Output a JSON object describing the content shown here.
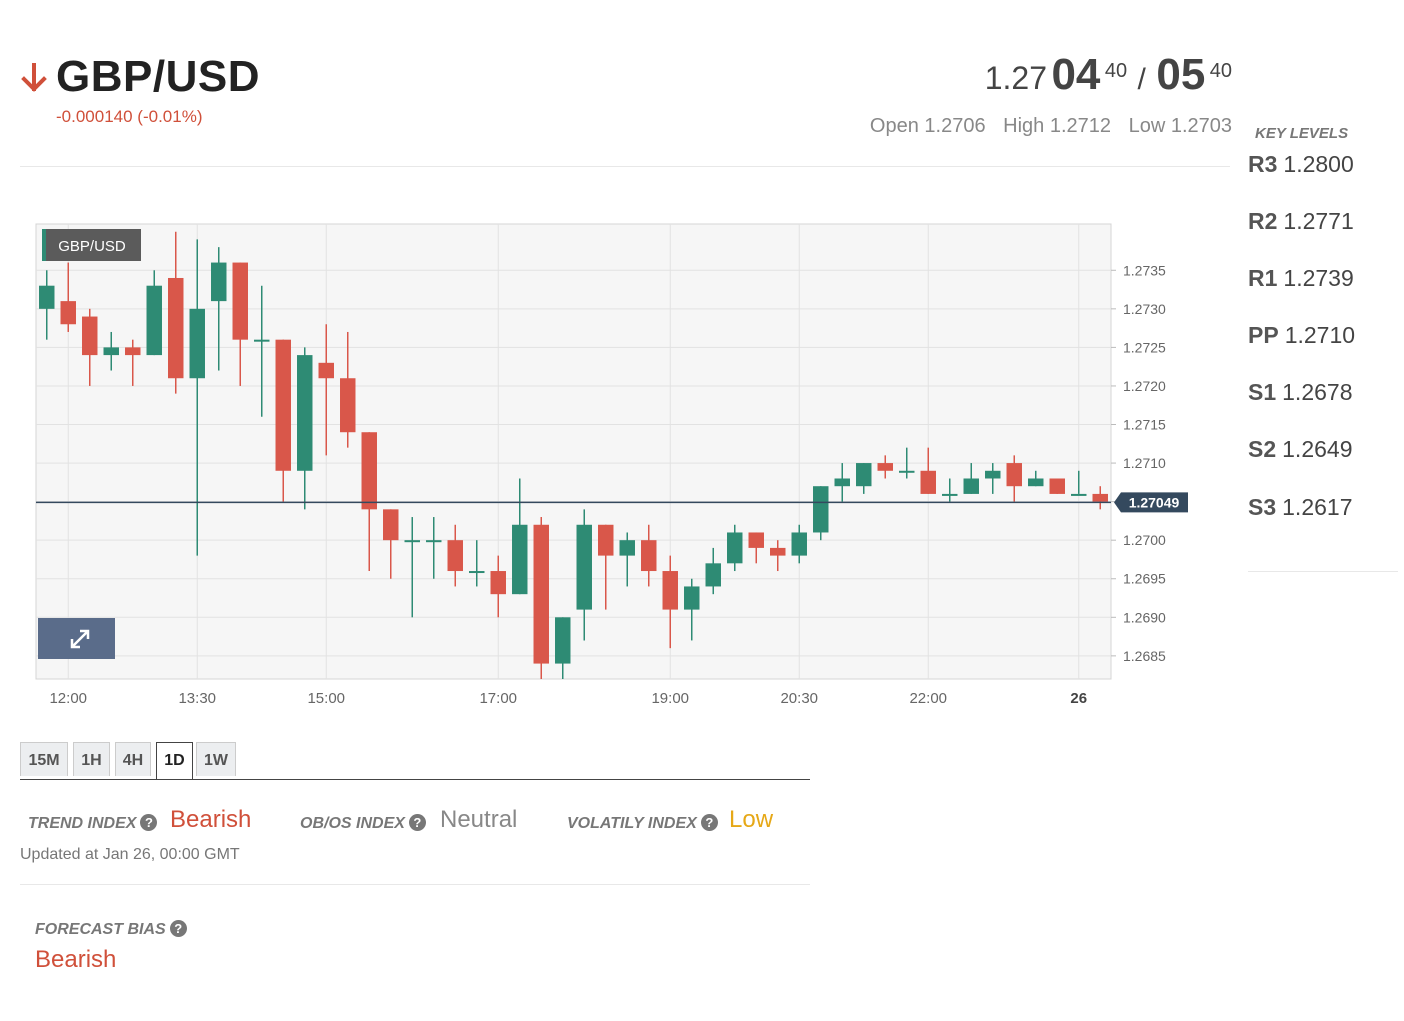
{
  "header": {
    "pair": "GBP/USD",
    "direction_icon": "arrow-down-icon",
    "change": "-0.000140 (-0.01%)",
    "bid": {
      "base": "1.27",
      "big": "04",
      "sup": "40"
    },
    "ask": {
      "big": "05",
      "sup": "40"
    },
    "slash": "/",
    "open": "Open 1.2706",
    "high": "High 1.2712",
    "low": "Low 1.2703"
  },
  "key_levels": {
    "title": "KEY LEVELS",
    "levels": [
      {
        "name": "R3",
        "value": "1.2800"
      },
      {
        "name": "R2",
        "value": "1.2771"
      },
      {
        "name": "R1",
        "value": "1.2739"
      },
      {
        "name": "PP",
        "value": "1.2710"
      },
      {
        "name": "S1",
        "value": "1.2678"
      },
      {
        "name": "S2",
        "value": "1.2649"
      },
      {
        "name": "S3",
        "value": "1.2617"
      }
    ]
  },
  "colors": {
    "up": "#2e8b74",
    "down": "#d9574a",
    "bearish": "#d0503a",
    "neutral": "#888888",
    "low": "#e6a817",
    "price_line": "#34495e"
  },
  "chart_data": {
    "type": "candlestick",
    "title": "GBP/USD",
    "ylim": [
      1.2682,
      1.2741
    ],
    "y_ticks": [
      "1.2735",
      "1.2730",
      "1.2725",
      "1.2720",
      "1.2715",
      "1.2710",
      "1.2705",
      "1.2700",
      "1.2695",
      "1.2690",
      "1.2685"
    ],
    "x_ticks": [
      "12:00",
      "13:30",
      "15:00",
      "17:00",
      "19:00",
      "20:30",
      "22:00",
      "26"
    ],
    "x_ticks_bold": [
      "26"
    ],
    "current_price": "1.27049",
    "current_value": 1.27049,
    "candles": [
      {
        "o": 1.273,
        "h": 1.2735,
        "l": 1.2726,
        "c": 1.2733
      },
      {
        "o": 1.2731,
        "h": 1.2736,
        "l": 1.2727,
        "c": 1.2728
      },
      {
        "o": 1.2729,
        "h": 1.273,
        "l": 1.272,
        "c": 1.2724
      },
      {
        "o": 1.2724,
        "h": 1.2727,
        "l": 1.2722,
        "c": 1.2725
      },
      {
        "o": 1.2725,
        "h": 1.2726,
        "l": 1.272,
        "c": 1.2724
      },
      {
        "o": 1.2724,
        "h": 1.2735,
        "l": 1.2724,
        "c": 1.2733
      },
      {
        "o": 1.2734,
        "h": 1.274,
        "l": 1.2719,
        "c": 1.2721
      },
      {
        "o": 1.2721,
        "h": 1.2739,
        "l": 1.2698,
        "c": 1.273
      },
      {
        "o": 1.2731,
        "h": 1.2738,
        "l": 1.2722,
        "c": 1.2736
      },
      {
        "o": 1.2736,
        "h": 1.2736,
        "l": 1.272,
        "c": 1.2726
      },
      {
        "o": 1.2726,
        "h": 1.2733,
        "l": 1.2716,
        "c": 1.2726
      },
      {
        "o": 1.2726,
        "h": 1.2726,
        "l": 1.2705,
        "c": 1.2709
      },
      {
        "o": 1.2709,
        "h": 1.2725,
        "l": 1.2704,
        "c": 1.2724
      },
      {
        "o": 1.2723,
        "h": 1.2728,
        "l": 1.2711,
        "c": 1.2721
      },
      {
        "o": 1.2721,
        "h": 1.2727,
        "l": 1.2712,
        "c": 1.2714
      },
      {
        "o": 1.2714,
        "h": 1.2714,
        "l": 1.2696,
        "c": 1.2704
      },
      {
        "o": 1.2704,
        "h": 1.2703,
        "l": 1.2695,
        "c": 1.27
      },
      {
        "o": 1.27,
        "h": 1.2703,
        "l": 1.269,
        "c": 1.27
      },
      {
        "o": 1.27,
        "h": 1.2703,
        "l": 1.2695,
        "c": 1.27
      },
      {
        "o": 1.27,
        "h": 1.2702,
        "l": 1.2694,
        "c": 1.2696
      },
      {
        "o": 1.2696,
        "h": 1.27,
        "l": 1.2694,
        "c": 1.2696
      },
      {
        "o": 1.2696,
        "h": 1.2698,
        "l": 1.269,
        "c": 1.2693
      },
      {
        "o": 1.2693,
        "h": 1.2708,
        "l": 1.2693,
        "c": 1.2702
      },
      {
        "o": 1.2702,
        "h": 1.2703,
        "l": 1.2682,
        "c": 1.2684
      },
      {
        "o": 1.2684,
        "h": 1.269,
        "l": 1.2682,
        "c": 1.269
      },
      {
        "o": 1.2691,
        "h": 1.2704,
        "l": 1.2687,
        "c": 1.2702
      },
      {
        "o": 1.2702,
        "h": 1.2702,
        "l": 1.2691,
        "c": 1.2698
      },
      {
        "o": 1.2698,
        "h": 1.2701,
        "l": 1.2694,
        "c": 1.27
      },
      {
        "o": 1.27,
        "h": 1.2702,
        "l": 1.2694,
        "c": 1.2696
      },
      {
        "o": 1.2696,
        "h": 1.2698,
        "l": 1.2686,
        "c": 1.2691
      },
      {
        "o": 1.2691,
        "h": 1.2695,
        "l": 1.2687,
        "c": 1.2694
      },
      {
        "o": 1.2694,
        "h": 1.2699,
        "l": 1.2693,
        "c": 1.2697
      },
      {
        "o": 1.2697,
        "h": 1.2702,
        "l": 1.2696,
        "c": 1.2701
      },
      {
        "o": 1.2701,
        "h": 1.2701,
        "l": 1.2697,
        "c": 1.2699
      },
      {
        "o": 1.2699,
        "h": 1.27,
        "l": 1.2696,
        "c": 1.2698
      },
      {
        "o": 1.2698,
        "h": 1.2702,
        "l": 1.2697,
        "c": 1.2701
      },
      {
        "o": 1.2701,
        "h": 1.2707,
        "l": 1.27,
        "c": 1.2707
      },
      {
        "o": 1.2707,
        "h": 1.271,
        "l": 1.2705,
        "c": 1.2708
      },
      {
        "o": 1.2707,
        "h": 1.271,
        "l": 1.2706,
        "c": 1.271
      },
      {
        "o": 1.271,
        "h": 1.2711,
        "l": 1.2708,
        "c": 1.2709
      },
      {
        "o": 1.2709,
        "h": 1.2712,
        "l": 1.2708,
        "c": 1.2709
      },
      {
        "o": 1.2709,
        "h": 1.2712,
        "l": 1.2706,
        "c": 1.2706
      },
      {
        "o": 1.2706,
        "h": 1.2708,
        "l": 1.2705,
        "c": 1.2706
      },
      {
        "o": 1.2706,
        "h": 1.271,
        "l": 1.2706,
        "c": 1.2708
      },
      {
        "o": 1.2708,
        "h": 1.271,
        "l": 1.2706,
        "c": 1.2709
      },
      {
        "o": 1.271,
        "h": 1.2711,
        "l": 1.2705,
        "c": 1.2707
      },
      {
        "o": 1.2707,
        "h": 1.2709,
        "l": 1.2707,
        "c": 1.2708
      },
      {
        "o": 1.2708,
        "h": 1.2708,
        "l": 1.2706,
        "c": 1.2706
      },
      {
        "o": 1.2706,
        "h": 1.2709,
        "l": 1.2706,
        "c": 1.2706
      },
      {
        "o": 1.2706,
        "h": 1.2707,
        "l": 1.2704,
        "c": 1.2705
      }
    ]
  },
  "tabs": [
    {
      "label": "15M",
      "active": false
    },
    {
      "label": "1H",
      "active": false
    },
    {
      "label": "4H",
      "active": false
    },
    {
      "label": "1D",
      "active": true
    },
    {
      "label": "1W",
      "active": false
    }
  ],
  "indices": {
    "trend": {
      "label": "TREND INDEX",
      "value": "Bearish"
    },
    "obos": {
      "label": "OB/OS INDEX",
      "value": "Neutral"
    },
    "volatility": {
      "label": "VOLATILY INDEX",
      "value": "Low"
    },
    "help_icon": "?"
  },
  "updated": "Updated at Jan 26, 00:00 GMT",
  "forecast": {
    "label": "FORECAST BIAS",
    "value": "Bearish"
  }
}
